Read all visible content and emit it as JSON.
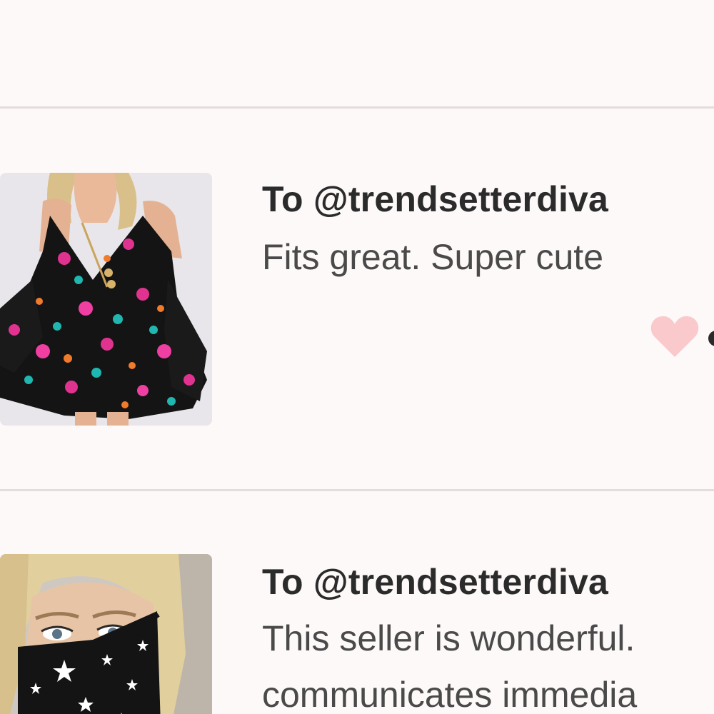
{
  "colors": {
    "background": "#fdf9f8",
    "divider": "#e3dedd",
    "heart": "#f9c9cb",
    "text_primary": "#2b2b2b",
    "text_secondary": "#4a4a4a"
  },
  "comments": [
    {
      "to": "To @trendsetterdiva",
      "lines": [
        "Fits great. Super cute"
      ],
      "image_icon": "floral-dress-photo",
      "like_icon": "heart-icon"
    },
    {
      "to": "To @trendsetterdiva",
      "lines": [
        "This seller is wonderful.",
        "communicates immedia"
      ],
      "image_icon": "face-mask-photo"
    }
  ]
}
